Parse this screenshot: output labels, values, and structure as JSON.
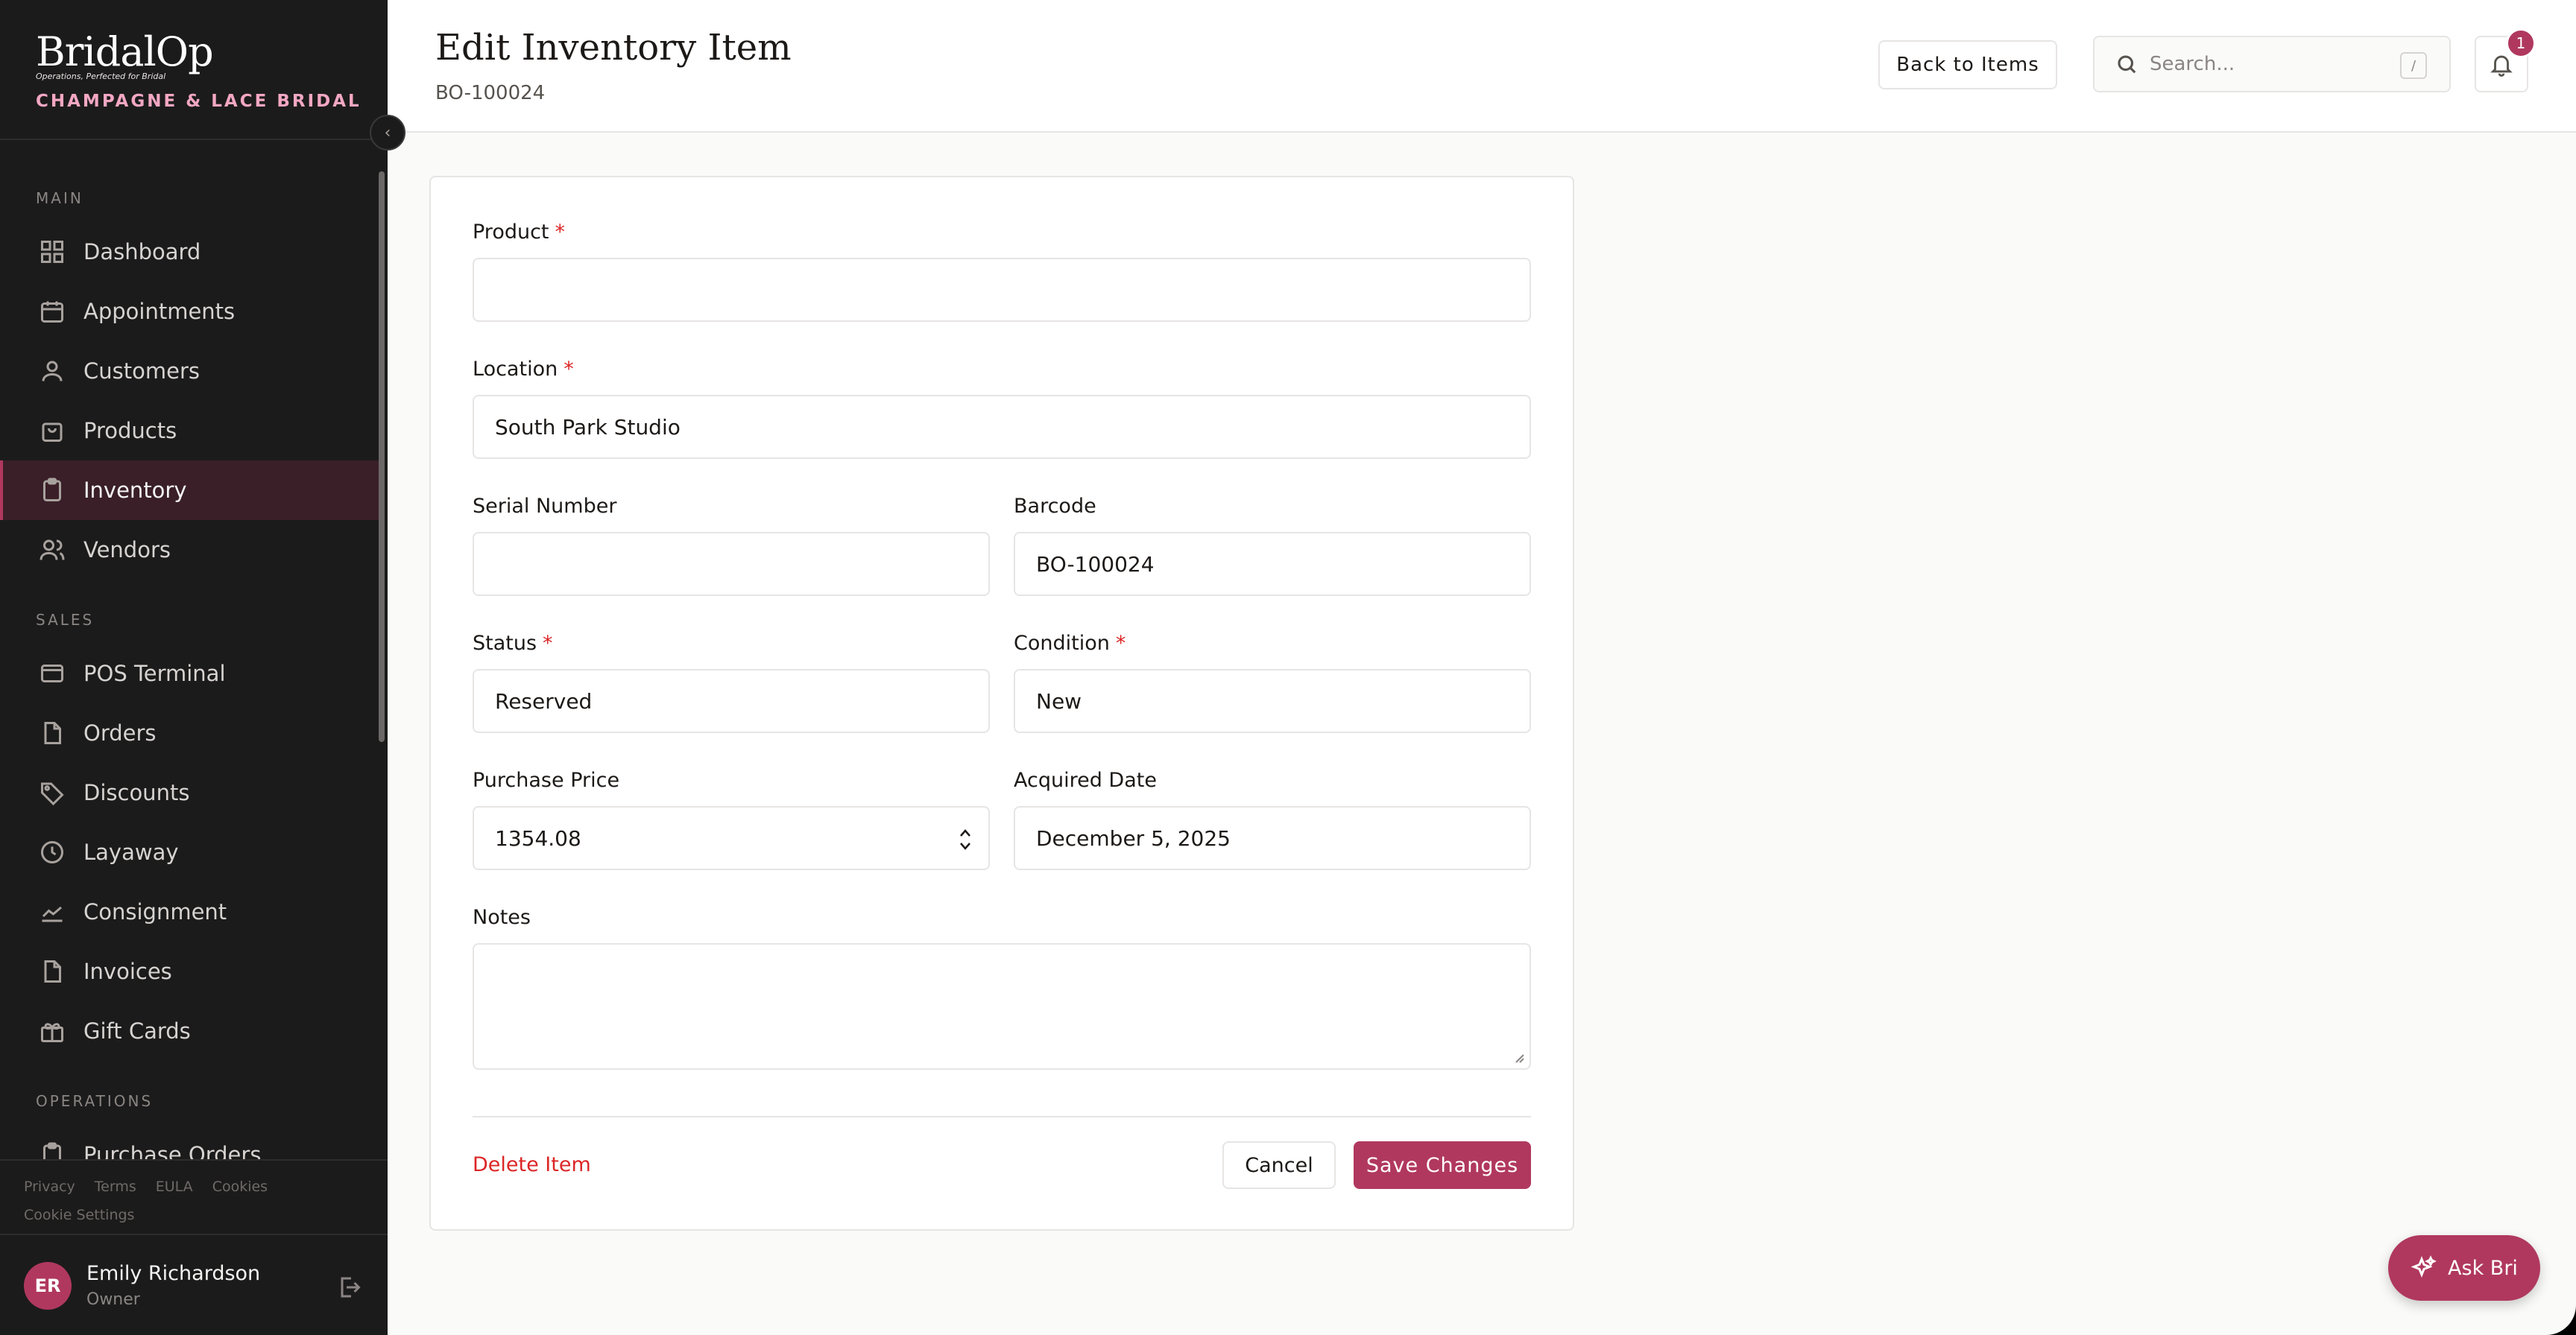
{
  "brand": {
    "logo": "BridalOp",
    "tagline": "Operations, Perfected for Bridal",
    "store": "CHAMPAGNE & LACE BRIDAL"
  },
  "sidebar": {
    "sections": [
      {
        "title": "MAIN"
      },
      {
        "title": "SALES"
      },
      {
        "title": "OPERATIONS"
      }
    ],
    "items": [
      {
        "label": "Dashboard",
        "icon": "grid-icon"
      },
      {
        "label": "Appointments",
        "icon": "calendar-icon"
      },
      {
        "label": "Customers",
        "icon": "user-icon"
      },
      {
        "label": "Products",
        "icon": "bag-icon"
      },
      {
        "label": "Inventory",
        "icon": "clipboard-icon",
        "active": true
      },
      {
        "label": "Vendors",
        "icon": "users-icon"
      },
      {
        "label": "POS Terminal",
        "icon": "terminal-icon"
      },
      {
        "label": "Orders",
        "icon": "file-icon"
      },
      {
        "label": "Discounts",
        "icon": "tag-icon"
      },
      {
        "label": "Layaway",
        "icon": "clock-icon"
      },
      {
        "label": "Consignment",
        "icon": "chart-icon"
      },
      {
        "label": "Invoices",
        "icon": "file-icon"
      },
      {
        "label": "Gift Cards",
        "icon": "gift-icon"
      },
      {
        "label": "Purchase Orders",
        "icon": "clipboard-icon"
      }
    ],
    "legal": [
      "Privacy",
      "Terms",
      "EULA",
      "Cookies"
    ],
    "cookie_settings": "Cookie Settings",
    "user": {
      "initials": "ER",
      "name": "Emily Richardson",
      "role": "Owner"
    }
  },
  "header": {
    "title": "Edit Inventory Item",
    "subtitle": "BO-100024",
    "back_label": "Back to Items",
    "search_placeholder": "Search...",
    "search_shortcut": "/",
    "notification_count": "1"
  },
  "form": {
    "product": {
      "label": "Product",
      "value": ""
    },
    "location": {
      "label": "Location",
      "value": "South Park Studio"
    },
    "serial": {
      "label": "Serial Number",
      "value": ""
    },
    "barcode": {
      "label": "Barcode",
      "value": "BO-100024"
    },
    "status": {
      "label": "Status",
      "value": "Reserved"
    },
    "condition": {
      "label": "Condition",
      "value": "New"
    },
    "price": {
      "label": "Purchase Price",
      "value": "1354.08"
    },
    "acquired": {
      "label": "Acquired Date",
      "value": "December 5, 2025"
    },
    "notes": {
      "label": "Notes",
      "value": ""
    },
    "required_mark": "*",
    "delete_label": "Delete Item",
    "cancel_label": "Cancel",
    "save_label": "Save Changes"
  },
  "assistant": {
    "label": "Ask Bri"
  },
  "colors": {
    "accent": "#b0385f",
    "sidebar_bg": "#1c1b1b",
    "danger": "#dc2626"
  }
}
